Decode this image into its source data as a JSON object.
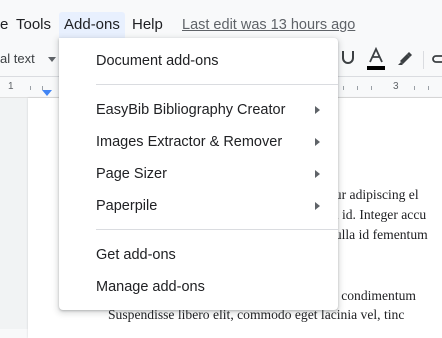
{
  "menubar": {
    "items": [
      {
        "label": "e"
      },
      {
        "label": "Tools"
      },
      {
        "label": "Add-ons"
      },
      {
        "label": "Help"
      }
    ],
    "last_edit": "Last edit was 13 hours ago"
  },
  "toolbar": {
    "style_select": "al text"
  },
  "ruler": {
    "numbers": [
      "1",
      "3"
    ]
  },
  "document": {
    "lines": [
      "etur adipiscing el",
      "lla id. Integer accu",
      "Nulla id fementum",
      "ue condimentum",
      "Suspendisse libero elit, commodo eget lacinia vel, tinc"
    ]
  },
  "dropdown": {
    "header": "Document add-ons",
    "items": [
      "EasyBib Bibliography Creator",
      "Images Extractor & Remover",
      "Page Sizer",
      "Paperpile"
    ],
    "footer_items": [
      "Get add-ons",
      "Manage add-ons"
    ]
  },
  "colors": {
    "active_menu_bg": "#e8f0fe",
    "text_color_swatch": "#000000"
  }
}
